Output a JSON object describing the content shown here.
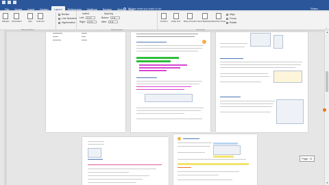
{
  "ribbon_tabs": [
    "File",
    "Home",
    "Insert",
    "Design",
    "Layout",
    "References",
    "Mailings",
    "Review",
    "View",
    "Help"
  ],
  "tell_me": "Tell me what you want to do",
  "share": "Share",
  "page_setup": {
    "margins": "Margins",
    "orientation": "Orientation",
    "size": "Size",
    "columns": "Columns",
    "breaks": "Breaks",
    "line_numbers": "Line Numbers",
    "hyphenation": "Hyphenation",
    "group": "Page Setup"
  },
  "paragraph": {
    "indent": "Indent",
    "spacing": "Spacing",
    "left": "Left:",
    "left_value": "0 cm",
    "right": "Right:",
    "right_value": "0 cm",
    "before": "Before:",
    "before_value": "0 pt",
    "after": "After:",
    "after_value": "8 pt",
    "group": "Paragraph"
  },
  "arrange": {
    "position": "Position",
    "wrap_text": "Wrap Text",
    "bring_forward": "Bring Forward",
    "send_backward": "Send Backward",
    "selection_pane": "Selection Pane",
    "align": "Align",
    "group_btn": "Group",
    "rotate": "Rotate",
    "group": "Arrange"
  },
  "page_tooltip": "Page: 11",
  "colors": {
    "ribbon_blue": "#2b579a",
    "highlight_green": "#2ebd3a",
    "highlight_pink": "#d642d1",
    "highlight_yellow": "#f3e56b",
    "accent_orange": "#e8761c"
  }
}
